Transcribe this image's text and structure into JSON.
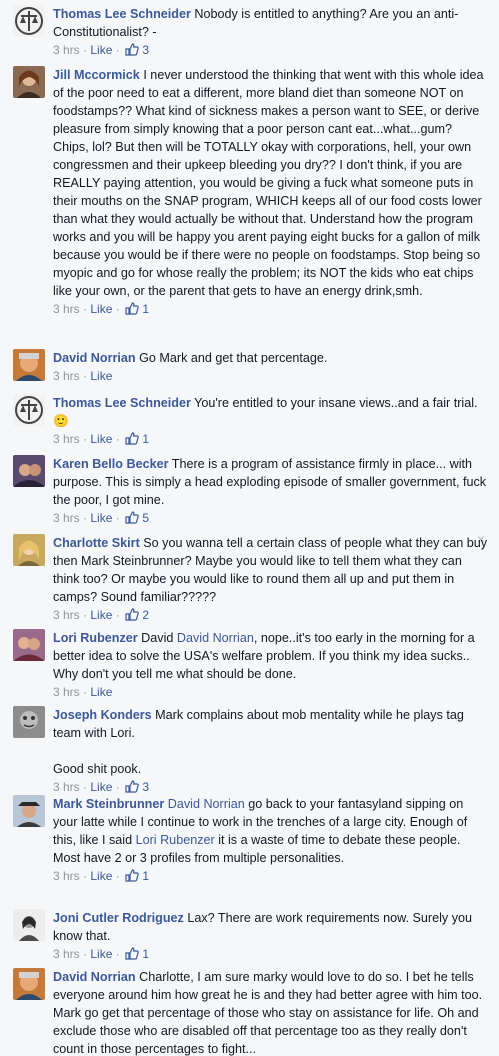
{
  "comments": [
    {
      "author": "Thomas Lee Schneider",
      "text": "Nobody is entitled to anything? Are you an anti-Constitutionalist? -",
      "time": "3 hrs",
      "like_label": "Like",
      "likes": "3",
      "avatar": "scales-avatar"
    },
    {
      "author": "Jill Mccormick",
      "text": "I never understood the thinking that went with this whole idea of the poor need to eat a different, more bland diet than someone NOT on foodstamps?? What kind of sickness makes a person want to SEE, or derive pleasure from simply knowing that a poor person cant eat...what...gum? Chips, lol? But then will be TOTALLY okay with corporations, hell, your own congressmen and their upkeep bleeding you dry?? I don't think, if you are REALLY paying attention, you would be giving a fuck what someone puts in their mouths on the SNAP program, WHICH keeps all of our food costs lower than what they would actually be without that. Understand how the program works and you will be happy you arent paying eight bucks for a gallon of milk because you would be if there were no people on foodstamps. Stop being so myopic and go for whose really the problem; its NOT the kids who eat chips like your own, or the parent that gets to have an energy drink,smh.",
      "time": "3 hrs",
      "like_label": "Like",
      "likes": "1",
      "avatar": "woman-avatar"
    },
    {
      "author": "David Norrian",
      "text": "Go Mark and get that percentage.",
      "time": "3 hrs",
      "like_label": "Like",
      "likes": "",
      "avatar": "man-avatar"
    },
    {
      "author": "Thomas Lee Schneider",
      "text": "You're entitled to your insane views..and a fair trial. 🙂",
      "time": "3 hrs",
      "like_label": "Like",
      "likes": "1",
      "avatar": "scales-avatar"
    },
    {
      "author": "Karen Bello Becker",
      "text": "There is a program of assistance firmly in place... with purpose. This is simply a head exploding episode of smaller government, fuck the poor, I got mine.",
      "time": "3 hrs",
      "like_label": "Like",
      "likes": "5",
      "avatar": "woman-avatar-2"
    },
    {
      "author": "Charlotte Skirt",
      "text": "So you wanna tell a certain class of people what they can buy then Mark Steinbrunner? Maybe you would like to tell them what they can think too? Or maybe you would like to round them all up and put them in camps? Sound familiar?????",
      "time": "3 hrs",
      "like_label": "Like",
      "likes": "2",
      "avatar": "woman-avatar-3",
      "close": "×"
    },
    {
      "author": "Lori Rubenzer",
      "pre_text": "David ",
      "mention": "David Norrian",
      "text": ", nope..it's too early in the morning for a better idea to solve the USA's welfare problem. If you think my idea sucks.. Why don't you tell me what should be done.",
      "time": "3 hrs",
      "like_label": "Like",
      "likes": "",
      "avatar": "couple-avatar"
    },
    {
      "author": "Joseph Konders",
      "text": "Mark complains about mob mentality while he plays tag team with Lori.",
      "text2": "Good shit pook.",
      "time": "3 hrs",
      "like_label": "Like",
      "likes": "3",
      "avatar": "stone-avatar"
    },
    {
      "author": "Mark Steinbrunner",
      "mention": "David Norrian",
      "text": "go back to your fantasyland sipping on your latte while I continue to work in the trenches of a large city. Enough of this, like I said",
      "mention2": "Lori Rubenzer",
      "text_after": "it is a waste of time to debate these people. Most have 2 or 3 profiles from multiple personalities.",
      "time": "3 hrs",
      "like_label": "Like",
      "likes": "1",
      "avatar": "hat-man-avatar"
    },
    {
      "author": "Joni Cutler Rodriguez",
      "text": "Lax? There are work requirements now. Surely you know that.",
      "time": "3 hrs",
      "like_label": "Like",
      "likes": "1",
      "avatar": "bw-woman-avatar"
    },
    {
      "author": "David Norrian",
      "text": "Charlotte, I am sure marky would love to do so. I bet he tells everyone around him how great he is and they had better agree with him too. Mark go get that percentage of those who stay on assistance for life. Oh and exclude those who are disabled off that percentage too as they really don't count in those percentages to fight...",
      "time": "",
      "like_label": "",
      "likes": "",
      "avatar": "man-avatar"
    }
  ],
  "colors": {
    "link": "#3b5998",
    "meta": "#90949c",
    "background": "#f6f7f9",
    "text": "#141823"
  },
  "icons": {
    "like": "thumbs-up-icon",
    "close": "close-icon"
  }
}
